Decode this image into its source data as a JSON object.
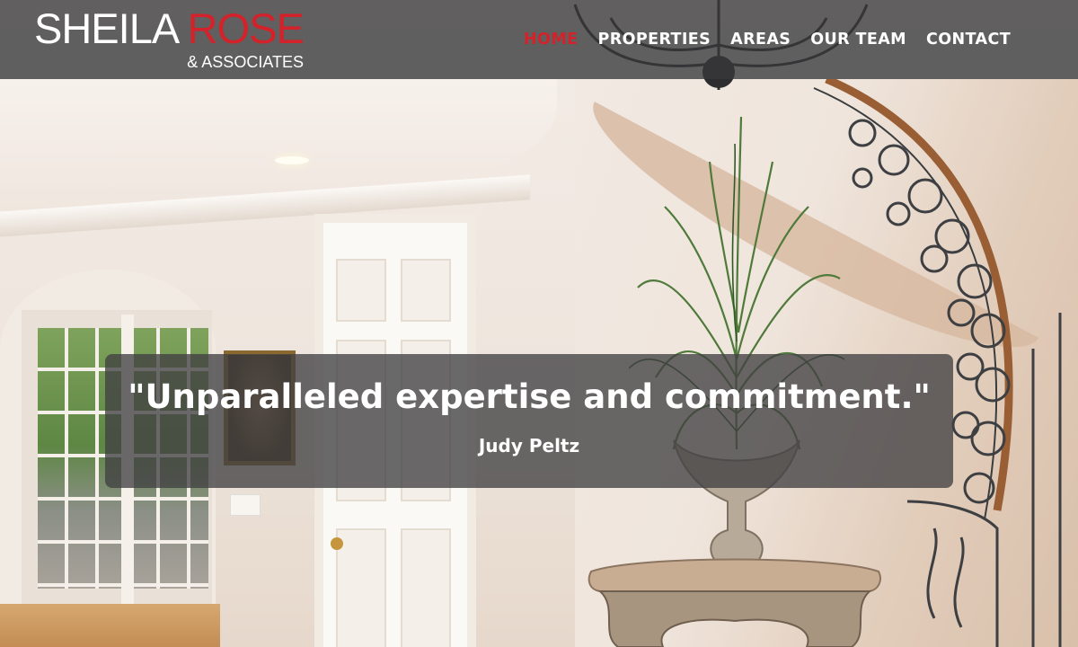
{
  "brand": {
    "first_name": "SHEILA",
    "last_name": "ROSE",
    "sub": "& ASSOCIATES",
    "accent_color": "#d3222a"
  },
  "nav": {
    "items": [
      {
        "label": "HOME",
        "active": true
      },
      {
        "label": "PROPERTIES",
        "active": false
      },
      {
        "label": "AREAS",
        "active": false
      },
      {
        "label": "OUR TEAM",
        "active": false
      },
      {
        "label": "CONTACT",
        "active": false
      }
    ]
  },
  "testimonial": {
    "quote": "\"Unparalleled expertise and commitment.\"",
    "author": "Judy Peltz"
  },
  "hero": {
    "image_subject": "entryway-with-curved-staircase-icon"
  }
}
